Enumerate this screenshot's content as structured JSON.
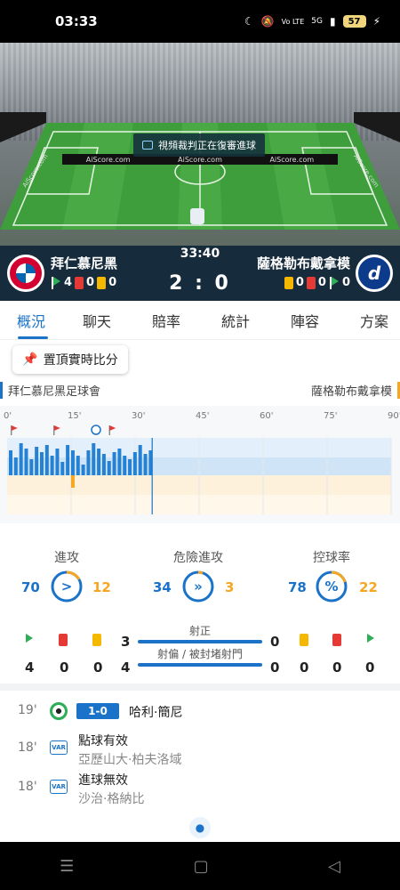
{
  "status_bar": {
    "time": "03:33",
    "network": "Vo LTE",
    "signal": "5G",
    "battery": "57"
  },
  "stadium": {
    "ad_board": [
      "AiScore.com",
      "AiScore.com",
      "AiScore.com"
    ],
    "side_ad_left": "AiScore.com",
    "side_ad_right": "AiScore.com",
    "video_banner": "視頻裁判正在復審進球"
  },
  "match": {
    "time": "33:40",
    "score": "2 : 0",
    "home": {
      "name": "拜仁慕尼黑",
      "corners": "4",
      "red_cards": "0",
      "yellow_cards": "0"
    },
    "away": {
      "name": "薩格勒布戴拿模",
      "yellow_cards": "0",
      "red_cards": "0",
      "corners": "0"
    }
  },
  "tabs": [
    "概況",
    "聊天",
    "賠率",
    "統計",
    "陣容",
    "方案"
  ],
  "pin_button": "置頂實時比分",
  "team_row": {
    "home_full": "拜仁慕尼黑足球會",
    "away_full": "薩格勒布戴拿模"
  },
  "timeline": {
    "ticks": [
      "0'",
      "15'",
      "30'",
      "45'",
      "60'",
      "75'",
      "90'"
    ],
    "current_minute": 34,
    "home_bars": [
      28,
      20,
      36,
      30,
      18,
      32,
      26,
      34,
      22,
      30,
      15,
      34,
      28,
      22,
      12,
      28,
      36,
      30,
      24,
      16,
      26,
      30,
      22,
      18,
      26,
      34,
      24,
      28
    ],
    "away_bars": [
      0,
      0,
      0,
      0,
      0,
      0,
      0,
      0,
      0,
      0,
      0,
      0,
      14,
      0,
      0,
      0,
      0,
      0,
      0,
      0,
      0,
      0,
      0,
      0,
      0,
      0,
      0,
      0
    ]
  },
  "stats": {
    "attacks": {
      "label": "進攻",
      "home": "70",
      "away": "12"
    },
    "dangerous": {
      "label": "危險進攻",
      "home": "34",
      "away": "3"
    },
    "possession": {
      "label": "控球率",
      "home": "78",
      "away": "22"
    }
  },
  "shots": {
    "on_target_label": "射正",
    "off_target_label": "射偏 / 被封堵射門",
    "home_on": "3",
    "home_off": "4",
    "away_on": "0",
    "away_off": "0",
    "home_corners": "4",
    "home_red": "0",
    "home_yellow": "0",
    "away_yellow": "0",
    "away_red": "0",
    "away_corners": "0"
  },
  "events": [
    {
      "minute": "19'",
      "type": "goal",
      "score": "1-0",
      "title": "哈利·簡尼",
      "sub": ""
    },
    {
      "minute": "18'",
      "type": "var",
      "badge": "VAR",
      "title": "點球有效",
      "sub": "亞歷山大·柏夫洛域"
    },
    {
      "minute": "18'",
      "type": "var",
      "badge": "VAR",
      "title": "進球無效",
      "sub": "沙治·格納比"
    }
  ],
  "colors": {
    "home": "#1a73c9",
    "away": "#f5a623",
    "header": "#162b3c"
  }
}
